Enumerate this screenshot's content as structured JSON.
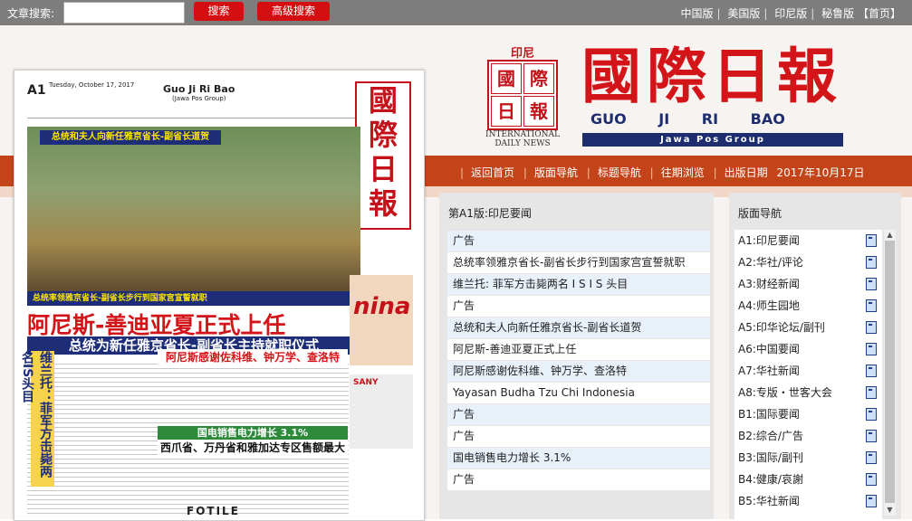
{
  "topbar": {
    "search_label": "文章搜索:",
    "search_value": "",
    "search_button": "搜索",
    "advanced_button": "高级搜索",
    "editions": [
      "中国版",
      "美国版",
      "印尼版",
      "秘鲁版"
    ],
    "home_link": "【首页】"
  },
  "masthead": {
    "seal_top": "印尼",
    "seal_chars": [
      "國",
      "際",
      "日",
      "報"
    ],
    "seal_en1": "INTERNATIONAL",
    "seal_en2": "DAILY NEWS",
    "title": "國際日報",
    "pinyin": "GUO JI RI BAO",
    "group": "Jawa Pos Group"
  },
  "nav": {
    "links": [
      "返回首页",
      "版面导航",
      "标题导航",
      "往期浏览"
    ],
    "date_label": "出版日期",
    "date_value": "2017年10月17日"
  },
  "newspaper": {
    "page_no": "A1",
    "date": "Tuesday, October 17, 2017",
    "name": "Guo Ji Ri Bao",
    "sub": "(Jawa Pos Group)",
    "masthead": "國際日報",
    "photo_caption_top": "总统和夫人向新任雅京省长-副省长道贺",
    "photo_caption_bottom": "总统率领雅京省长-副省长步行到国家宫宣誓就职",
    "headline": "阿尼斯-善迪亚夏正式上任",
    "subheadline": "总统为新任雅京省长-副省长主持就职仪式",
    "sub1": "阿尼斯感谢佐科维、钟万学、查洛特",
    "sub2": "国电销售电力增长 3.1%",
    "sub3": "西爪省、万丹省和雅加达专区售额最大",
    "vertical": "维兰托：菲军方击毙两名IS头目",
    "ad1": "nina",
    "ad2": "SANY",
    "footer_ad": "FOTILE"
  },
  "articles_panel": {
    "title": "第A1版:印尼要闻",
    "items": [
      "广告",
      "总统率领雅京省长-副省长步行到国家宫宣誓就职",
      "维兰托: 菲军方击毙两名 I S I S 头目",
      "广告",
      "总统和夫人向新任雅京省长-副省长道贺",
      "阿尼斯-善迪亚夏正式上任",
      "阿尼斯感谢佐科维、钟万学、查洛特",
      "Yayasan Budha Tzu Chi Indonesia",
      "广告",
      "广告",
      "国电销售电力增长 3.1%",
      "广告"
    ]
  },
  "pages_panel": {
    "title": "版面导航",
    "items": [
      "A1:印尼要闻",
      "A2:华社/评论",
      "A3:财经新闻",
      "A4:师生园地",
      "A5:印华论坛/副刊",
      "A6:中国要闻",
      "A7:华社新闻",
      "A8:专版・世客大会",
      "B1:国际要闻",
      "B2:综合/广告",
      "B3:国际/副刊",
      "B4:健康/哀謝",
      "B5:华社新闻"
    ]
  },
  "colors": {
    "brand_red": "#d3151a",
    "nav_band": "#c4441a",
    "navy": "#1e2d6e",
    "topbar": "#7d7d7d"
  }
}
